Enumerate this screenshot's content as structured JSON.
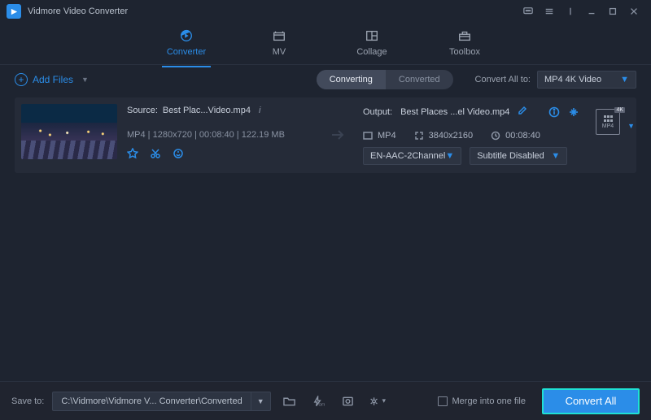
{
  "app": {
    "title": "Vidmore Video Converter"
  },
  "tabs": [
    {
      "id": "converter",
      "label": "Converter",
      "active": true
    },
    {
      "id": "mv",
      "label": "MV",
      "active": false
    },
    {
      "id": "collage",
      "label": "Collage",
      "active": false
    },
    {
      "id": "toolbox",
      "label": "Toolbox",
      "active": false
    }
  ],
  "toolbar": {
    "add_files": "Add Files",
    "segment": {
      "converting": "Converting",
      "converted": "Converted",
      "active": "converting"
    },
    "convert_all_to_label": "Convert All to:",
    "convert_all_to_value": "MP4 4K Video"
  },
  "item": {
    "source_label": "Source:",
    "source_name": "Best Plac...Video.mp4",
    "format": "MP4",
    "resolution": "1280x720",
    "duration": "00:08:40",
    "size": "122.19 MB",
    "output_label": "Output:",
    "output_name": "Best Places ...el Video.mp4",
    "out_format": "MP4",
    "out_resolution": "3840x2160",
    "out_duration": "00:08:40",
    "audio_value": "EN-AAC-2Channel",
    "subtitle_value": "Subtitle Disabled",
    "fmt_badge": "4K",
    "fmt_label": "MP4"
  },
  "bottom": {
    "save_to_label": "Save to:",
    "save_path": "C:\\Vidmore\\Vidmore V... Converter\\Converted",
    "merge_label": "Merge into one file",
    "convert_all": "Convert All"
  }
}
